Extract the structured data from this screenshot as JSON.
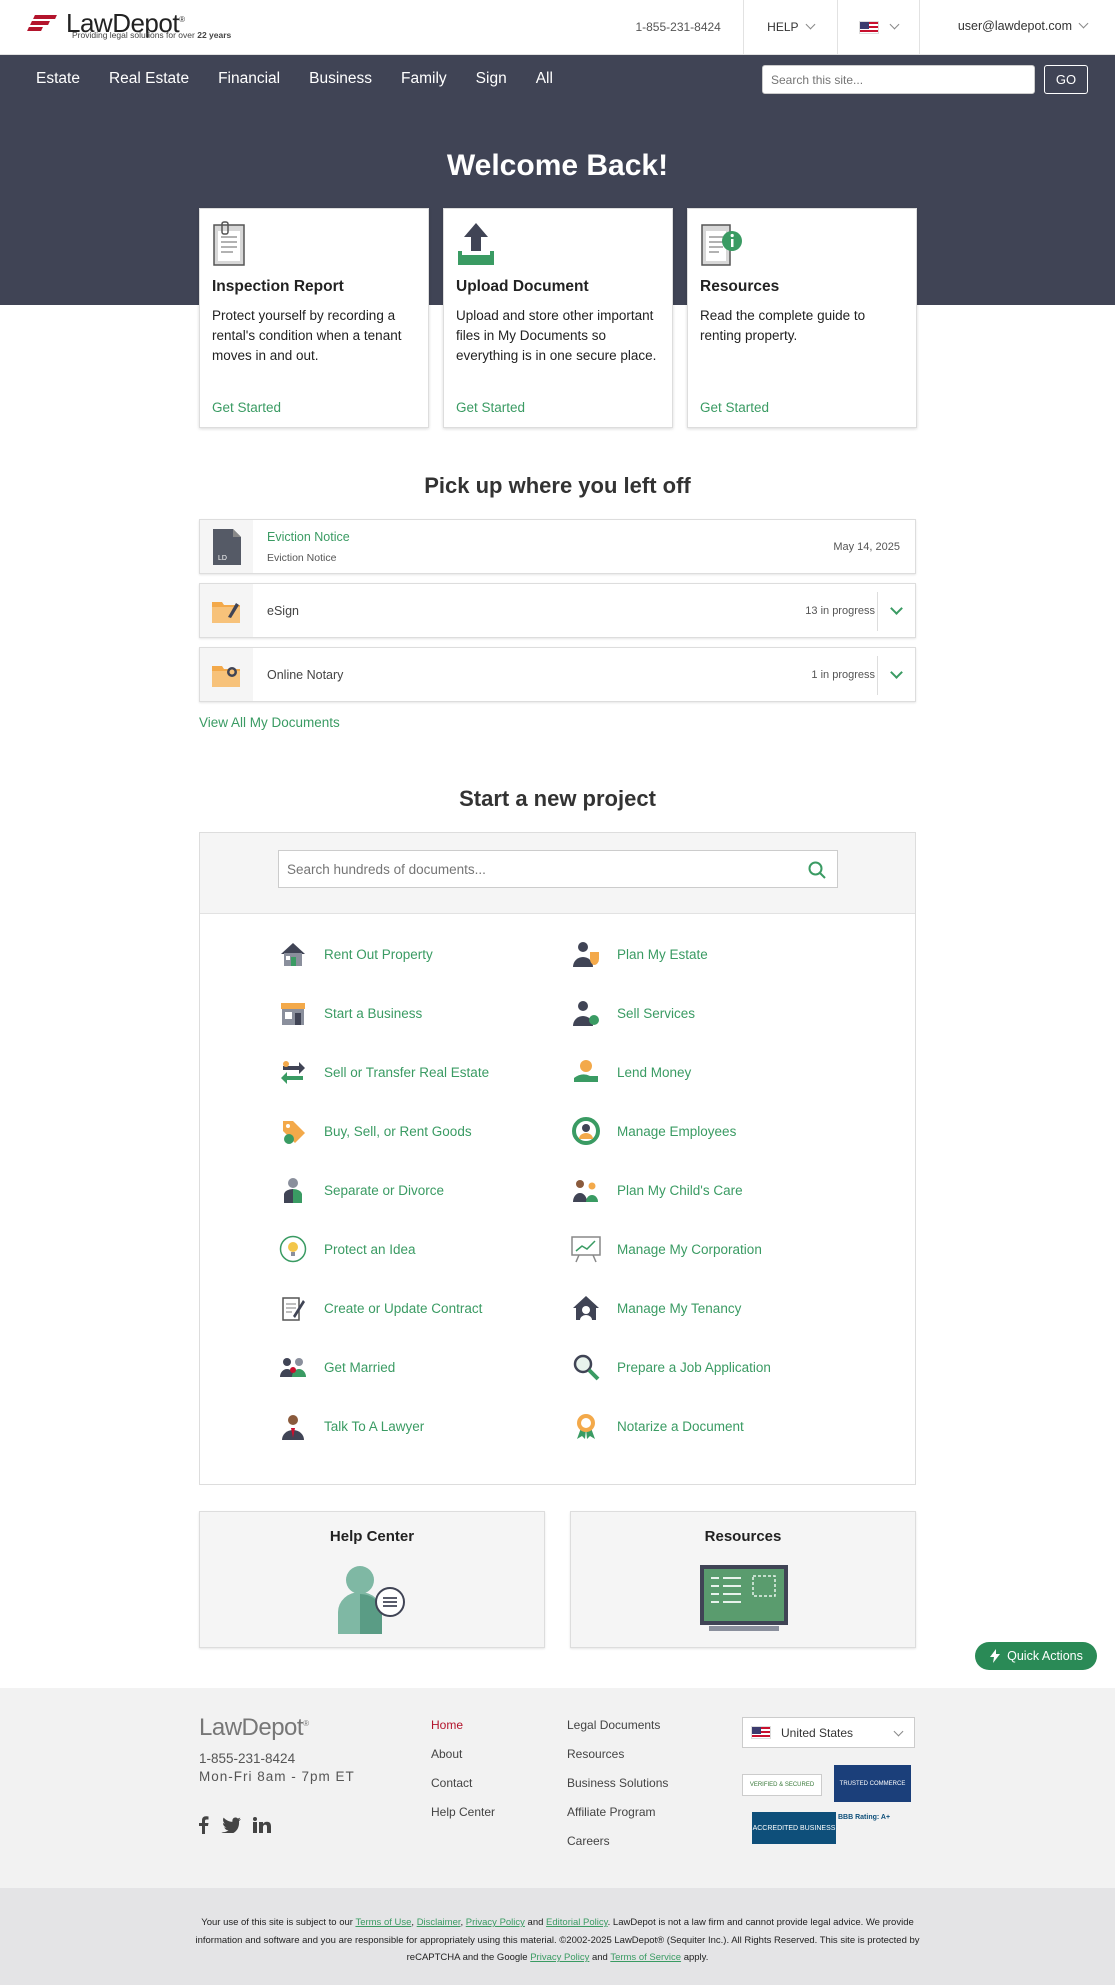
{
  "header": {
    "logo": "LawDepot",
    "logo_tagline_pre": "Providing legal solutions for over ",
    "logo_tagline_bold": "22 years",
    "phone": "1-855-231-8424",
    "help": "HELP",
    "user": "user@lawdepot.com"
  },
  "nav": {
    "items": [
      "Estate",
      "Real Estate",
      "Financial",
      "Business",
      "Family",
      "Sign",
      "All"
    ],
    "search_placeholder": "Search this site...",
    "go": "GO"
  },
  "hero": {
    "title": "Welcome Back!",
    "cards": [
      {
        "title": "Inspection Report",
        "desc": "Protect yourself by recording a rental's condition when a tenant moves in and out.",
        "cta": "Get Started"
      },
      {
        "title": "Upload Document",
        "desc": "Upload and store other important files in My Documents so everything is in one secure place.",
        "cta": "Get Started"
      },
      {
        "title": "Resources",
        "desc": "Read the complete guide to renting property.",
        "cta": "Get Started"
      }
    ]
  },
  "recent": {
    "title": "Pick up where you left off",
    "doc": {
      "name": "Eviction Notice",
      "type": "Eviction Notice",
      "date": "May 14, 2025",
      "icon_label": "LD"
    },
    "esign": {
      "name": "eSign",
      "meta": "13 in progress"
    },
    "notary": {
      "name": "Online Notary",
      "meta": "1 in progress"
    },
    "view_all": "View All My Documents"
  },
  "project": {
    "title": "Start a new project",
    "search_placeholder": "Search hundreds of documents...",
    "left": [
      "Rent Out Property",
      "Start a Business",
      "Sell or Transfer Real Estate",
      "Buy, Sell, or Rent Goods",
      "Separate or Divorce",
      "Protect an Idea",
      "Create or Update Contract",
      "Get Married",
      "Talk To A Lawyer"
    ],
    "right": [
      "Plan My Estate",
      "Sell Services",
      "Lend Money",
      "Manage Employees",
      "Plan My Child's Care",
      "Manage My Corporation",
      "Manage My Tenancy",
      "Prepare a Job Application",
      "Notarize a Document"
    ]
  },
  "boxes": {
    "help": "Help Center",
    "resources": "Resources"
  },
  "quick_actions": "Quick Actions",
  "footer": {
    "logo": "LawDepot",
    "phone": "1-855-231-8424",
    "hours": "Mon-Fri 8am - 7pm ET",
    "col1": [
      "Home",
      "About",
      "Contact",
      "Help Center"
    ],
    "col2": [
      "Legal Documents",
      "Resources",
      "Business Solutions",
      "Affiliate Program",
      "Careers"
    ],
    "country": "United States",
    "badge1": "VERIFIED & SECURED",
    "badge2": "TRUSTED COMMERCE",
    "badge3": "ACCREDITED BUSINESS",
    "badge3_rating": "BBB Rating: A+"
  },
  "legal": {
    "t1": "Your use of this site is subject to our ",
    "terms": "Terms of Use",
    "c1": ", ",
    "disclaimer": "Disclaimer",
    "c2": ", ",
    "privacy": "Privacy Policy",
    "and1": " and ",
    "editorial": "Editorial Policy",
    "t2": ". LawDepot is not a law firm and cannot provide legal advice. We provide information and software and you are responsible for appropriately using this material. ©2002-2025 LawDepot® (Sequiter Inc.). All Rights Reserved. This site is protected by reCAPTCHA and the Google ",
    "gprivacy": "Privacy Policy",
    "and2": " and ",
    "gterms": "Terms of Service",
    "t3": " apply."
  },
  "colors": {
    "green": "#3a9b63",
    "navy": "#404455",
    "red": "#b3142c"
  }
}
